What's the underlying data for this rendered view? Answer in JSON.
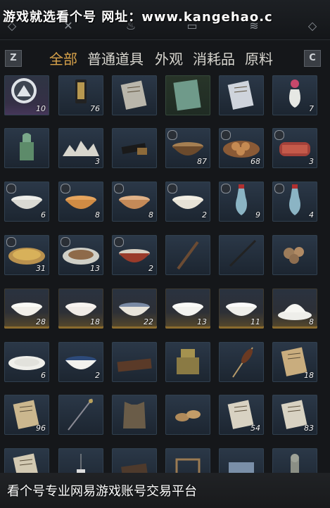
{
  "watermark_top": "游戏就选看个号  网址：www.kangehao.c",
  "watermark_bottom": "看个号专业网易游戏账号交易平台",
  "top_icons": [
    "q-key-icon",
    "sword-icon",
    "pouch-icon",
    "book-icon",
    "layers-icon",
    "e-key-icon"
  ],
  "tabs": {
    "left_key": "Z",
    "right_key": "C",
    "items": [
      "全部",
      "普通道具",
      "外观",
      "消耗品",
      "原料"
    ],
    "active": 0
  },
  "items": [
    {
      "name": "mountain-emblem-icon",
      "count": "10",
      "rarity": "purple",
      "lock": false
    },
    {
      "name": "token-pendant-icon",
      "count": "76",
      "rarity": "blue",
      "lock": false
    },
    {
      "name": "letter-icon",
      "count": "",
      "rarity": "blue",
      "lock": false
    },
    {
      "name": "green-book-icon",
      "count": "",
      "rarity": "green",
      "lock": false
    },
    {
      "name": "manual-icon",
      "count": "",
      "rarity": "blue",
      "lock": false
    },
    {
      "name": "vase-flower-icon",
      "count": "7",
      "rarity": "blue",
      "lock": false
    },
    {
      "name": "jade-seal-icon",
      "count": "",
      "rarity": "blue",
      "lock": false
    },
    {
      "name": "miniature-mountain-icon",
      "count": "3",
      "rarity": "blue",
      "lock": false
    },
    {
      "name": "ink-stick-icon",
      "count": "",
      "rarity": "blue",
      "lock": false
    },
    {
      "name": "stew-pot-icon",
      "count": "87",
      "rarity": "blue",
      "lock": true
    },
    {
      "name": "pastry-plate-icon",
      "count": "68",
      "rarity": "blue",
      "lock": true
    },
    {
      "name": "meat-tray-icon",
      "count": "3",
      "rarity": "blue",
      "lock": true
    },
    {
      "name": "dumpling-bowl-icon",
      "count": "6",
      "rarity": "blue",
      "lock": true
    },
    {
      "name": "noodle-bowl-icon",
      "count": "8",
      "rarity": "blue",
      "lock": true
    },
    {
      "name": "soup-bowl-icon",
      "count": "8",
      "rarity": "blue",
      "lock": true
    },
    {
      "name": "porridge-bowl-icon",
      "count": "2",
      "rarity": "blue",
      "lock": true
    },
    {
      "name": "wine-bottle-icon",
      "count": "9",
      "rarity": "blue",
      "lock": true
    },
    {
      "name": "wine-bottle-icon",
      "count": "4",
      "rarity": "blue",
      "lock": true
    },
    {
      "name": "fried-rice-plate-icon",
      "count": "31",
      "rarity": "blue",
      "lock": true
    },
    {
      "name": "stir-fry-plate-icon",
      "count": "13",
      "rarity": "blue",
      "lock": true
    },
    {
      "name": "spicy-dish-icon",
      "count": "2",
      "rarity": "blue",
      "lock": true
    },
    {
      "name": "brush-icon",
      "count": "",
      "rarity": "blue",
      "lock": false
    },
    {
      "name": "whip-icon",
      "count": "",
      "rarity": "blue",
      "lock": false
    },
    {
      "name": "mushroom-pile-icon",
      "count": "",
      "rarity": "blue",
      "lock": false
    },
    {
      "name": "porcelain-bowl-icon",
      "count": "28",
      "rarity": "gold",
      "lock": false
    },
    {
      "name": "floral-bowl-icon",
      "count": "18",
      "rarity": "gold",
      "lock": false
    },
    {
      "name": "patterned-bowl-icon",
      "count": "22",
      "rarity": "gold",
      "lock": false
    },
    {
      "name": "rooster-bowl-icon",
      "count": "13",
      "rarity": "gold",
      "lock": false
    },
    {
      "name": "white-bowl-icon",
      "count": "11",
      "rarity": "gold",
      "lock": false
    },
    {
      "name": "lidded-bowl-icon",
      "count": "8",
      "rarity": "gold",
      "lock": false
    },
    {
      "name": "shallow-dish-icon",
      "count": "6",
      "rarity": "blue",
      "lock": false
    },
    {
      "name": "rimmed-bowl-icon",
      "count": "2",
      "rarity": "blue",
      "lock": false
    },
    {
      "name": "tray-icon",
      "count": "",
      "rarity": "blue",
      "lock": false
    },
    {
      "name": "bronze-seal-icon",
      "count": "",
      "rarity": "blue",
      "lock": false
    },
    {
      "name": "skewer-icon",
      "count": "",
      "rarity": "blue",
      "lock": false
    },
    {
      "name": "scroll-letter-icon",
      "count": "18",
      "rarity": "blue",
      "lock": false
    },
    {
      "name": "old-book-icon",
      "count": "96",
      "rarity": "blue",
      "lock": false
    },
    {
      "name": "hairpin-icon",
      "count": "",
      "rarity": "blue",
      "lock": false
    },
    {
      "name": "armor-vest-icon",
      "count": "",
      "rarity": "blue",
      "lock": false
    },
    {
      "name": "straw-sandals-icon",
      "count": "",
      "rarity": "blue",
      "lock": false
    },
    {
      "name": "paper-note-icon",
      "count": "54",
      "rarity": "blue",
      "lock": false
    },
    {
      "name": "paper-note-icon",
      "count": "83",
      "rarity": "blue",
      "lock": false
    },
    {
      "name": "document-icon",
      "count": "",
      "rarity": "blue",
      "lock": false
    },
    {
      "name": "lamp-icon",
      "count": "",
      "rarity": "blue",
      "lock": false
    },
    {
      "name": "box-lid-icon",
      "count": "",
      "rarity": "blue",
      "lock": false
    },
    {
      "name": "frame-icon",
      "count": "",
      "rarity": "blue",
      "lock": false
    },
    {
      "name": "cloth-icon",
      "count": "",
      "rarity": "blue",
      "lock": false
    },
    {
      "name": "statue-icon",
      "count": "",
      "rarity": "blue",
      "lock": false
    }
  ]
}
